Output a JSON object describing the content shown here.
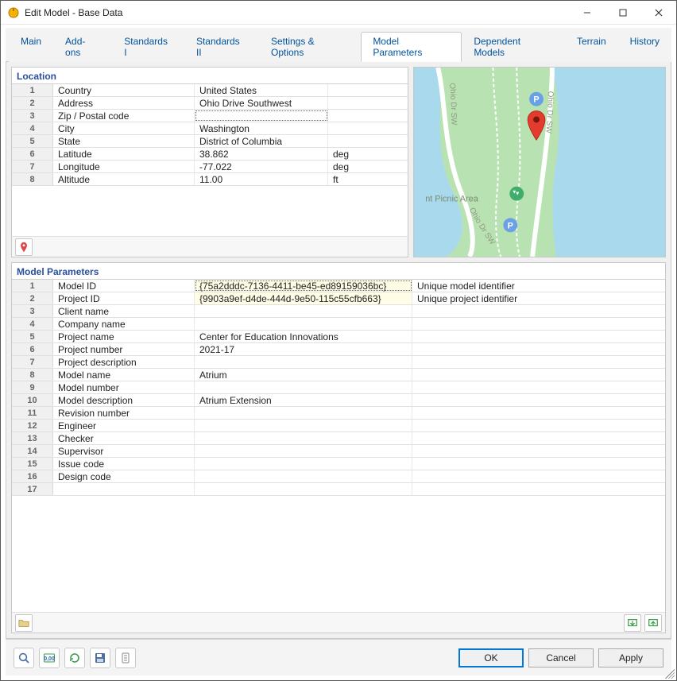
{
  "window": {
    "title": "Edit Model - Base Data"
  },
  "tabs": [
    {
      "label": "Main"
    },
    {
      "label": "Add-ons"
    },
    {
      "label": "Standards I"
    },
    {
      "label": "Standards II"
    },
    {
      "label": "Settings & Options"
    },
    {
      "label": "Model Parameters",
      "active": true
    },
    {
      "label": "Dependent Models"
    },
    {
      "label": "Terrain"
    },
    {
      "label": "History"
    }
  ],
  "location": {
    "header": "Location",
    "rows": [
      {
        "n": "1",
        "label": "Country",
        "value": "United States",
        "unit": ""
      },
      {
        "n": "2",
        "label": "Address",
        "value": "Ohio Drive Southwest",
        "unit": ""
      },
      {
        "n": "3",
        "label": "Zip / Postal code",
        "value": "",
        "unit": "",
        "selected": true
      },
      {
        "n": "4",
        "label": "City",
        "value": "Washington",
        "unit": ""
      },
      {
        "n": "5",
        "label": "State",
        "value": "District of Columbia",
        "unit": ""
      },
      {
        "n": "6",
        "label": "Latitude",
        "value": "38.862",
        "unit": "deg"
      },
      {
        "n": "7",
        "label": "Longitude",
        "value": "-77.022",
        "unit": "deg"
      },
      {
        "n": "8",
        "label": "Altitude",
        "value": "11.00",
        "unit": "ft"
      }
    ]
  },
  "params": {
    "header": "Model Parameters",
    "rows": [
      {
        "n": "1",
        "label": "Model ID",
        "value": "{75a2dddc-7136-4411-be45-ed89159036bc}",
        "desc": "Unique model identifier",
        "yellow": true,
        "selected": true
      },
      {
        "n": "2",
        "label": "Project ID",
        "value": "{9903a9ef-d4de-444d-9e50-115c55cfb663}",
        "desc": "Unique project identifier",
        "yellow": true
      },
      {
        "n": "3",
        "label": "Client name",
        "value": "",
        "desc": ""
      },
      {
        "n": "4",
        "label": "Company name",
        "value": "",
        "desc": ""
      },
      {
        "n": "5",
        "label": "Project name",
        "value": "Center for Education Innovations",
        "desc": ""
      },
      {
        "n": "6",
        "label": "Project number",
        "value": "2021-17",
        "desc": ""
      },
      {
        "n": "7",
        "label": "Project description",
        "value": "",
        "desc": ""
      },
      {
        "n": "8",
        "label": "Model name",
        "value": "Atrium",
        "desc": ""
      },
      {
        "n": "9",
        "label": "Model number",
        "value": "",
        "desc": ""
      },
      {
        "n": "10",
        "label": "Model description",
        "value": "Atrium Extension",
        "desc": ""
      },
      {
        "n": "11",
        "label": "Revision number",
        "value": "",
        "desc": ""
      },
      {
        "n": "12",
        "label": "Engineer",
        "value": "",
        "desc": ""
      },
      {
        "n": "13",
        "label": "Checker",
        "value": "",
        "desc": ""
      },
      {
        "n": "14",
        "label": "Supervisor",
        "value": "",
        "desc": ""
      },
      {
        "n": "15",
        "label": "Issue code",
        "value": "",
        "desc": ""
      },
      {
        "n": "16",
        "label": "Design code",
        "value": "",
        "desc": ""
      },
      {
        "n": "17",
        "label": "",
        "value": "",
        "desc": ""
      }
    ]
  },
  "map": {
    "road_label": "Ohio Dr SW",
    "area_label": "nt Picnic Area"
  },
  "footer": {
    "ok": "OK",
    "cancel": "Cancel",
    "apply": "Apply"
  }
}
